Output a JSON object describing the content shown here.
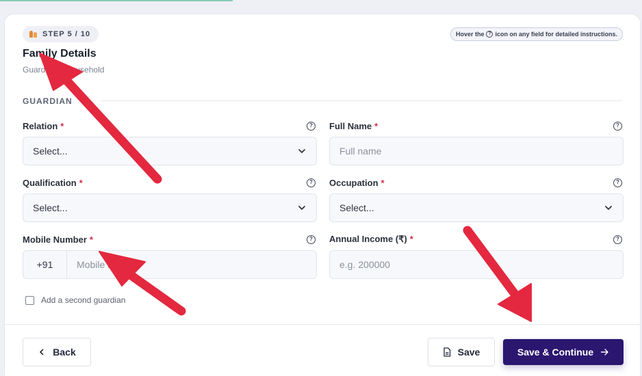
{
  "header": {
    "step_label": "STEP 5 / 10",
    "hint_prefix": "Hover the",
    "hint_suffix": "icon on any field for detailed instructions.",
    "hint_icon": "question-circle-icon"
  },
  "page": {
    "title": "Family Details",
    "subtitle": "Guardian & household"
  },
  "section": {
    "label": "GUARDIAN"
  },
  "fields": {
    "relation": {
      "label": "Relation",
      "value": "Select...",
      "required": "*"
    },
    "full_name": {
      "label": "Full Name",
      "placeholder": "Full name",
      "required": "*"
    },
    "qualification": {
      "label": "Qualification",
      "value": "Select...",
      "required": "*"
    },
    "occupation": {
      "label": "Occupation",
      "value": "Select...",
      "required": "*"
    },
    "mobile": {
      "label": "Mobile Number",
      "prefix": "+91",
      "placeholder": "Mobile number",
      "required": "*"
    },
    "income": {
      "label": "Annual Income (₹)",
      "placeholder": "e.g. 200000",
      "required": "*"
    }
  },
  "second_guardian": {
    "label": "Add a second guardian",
    "checked": false
  },
  "footer": {
    "back_label": "Back",
    "save_label": "Save",
    "continue_label": "Save & Continue"
  },
  "colors": {
    "primary": "#2b1670",
    "required": "#d32f45",
    "annotation_arrow": "#e3283f"
  }
}
